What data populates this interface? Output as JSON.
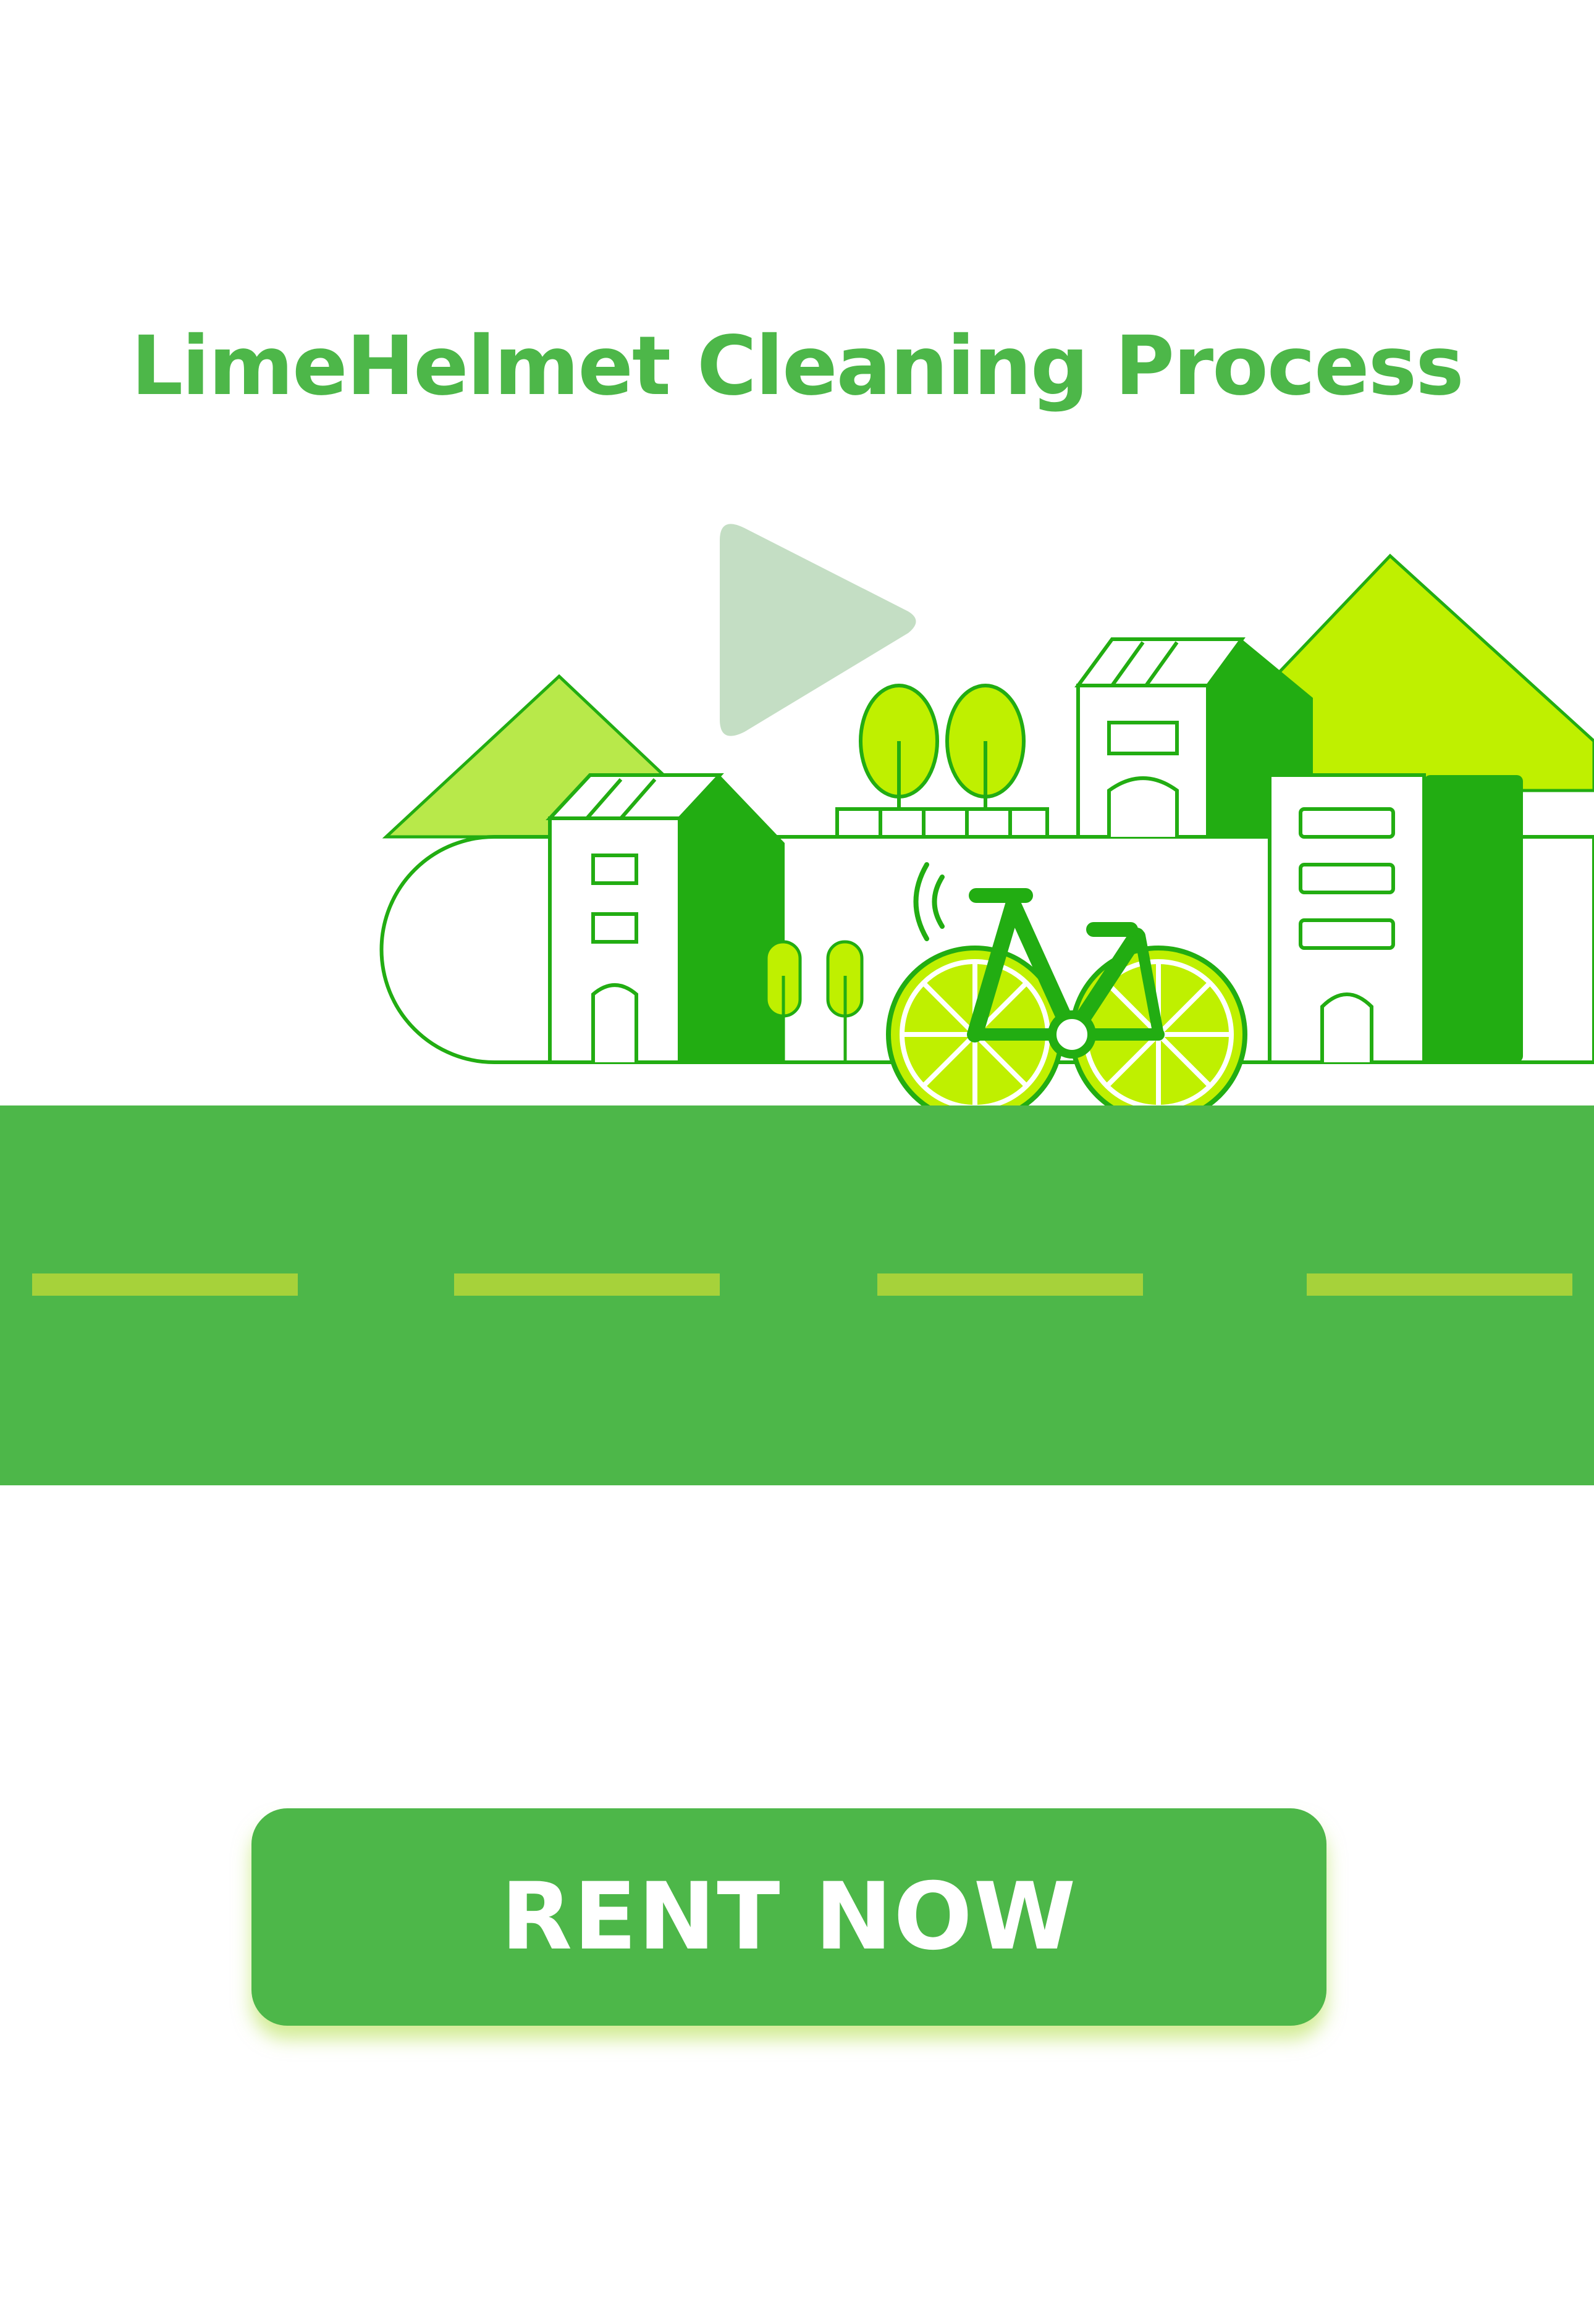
{
  "page": {
    "title": "LimeHelmet Cleaning Process"
  },
  "video": {
    "play_icon": "play-icon"
  },
  "cta": {
    "label": "RENT NOW"
  },
  "colors": {
    "brand_green": "#4db749",
    "dark_green": "#22ad12",
    "lime": "#bff000",
    "light_lime": "#a7e23c",
    "lane_marker": "#a6d23a",
    "play_overlay": "#c1dcc1"
  }
}
